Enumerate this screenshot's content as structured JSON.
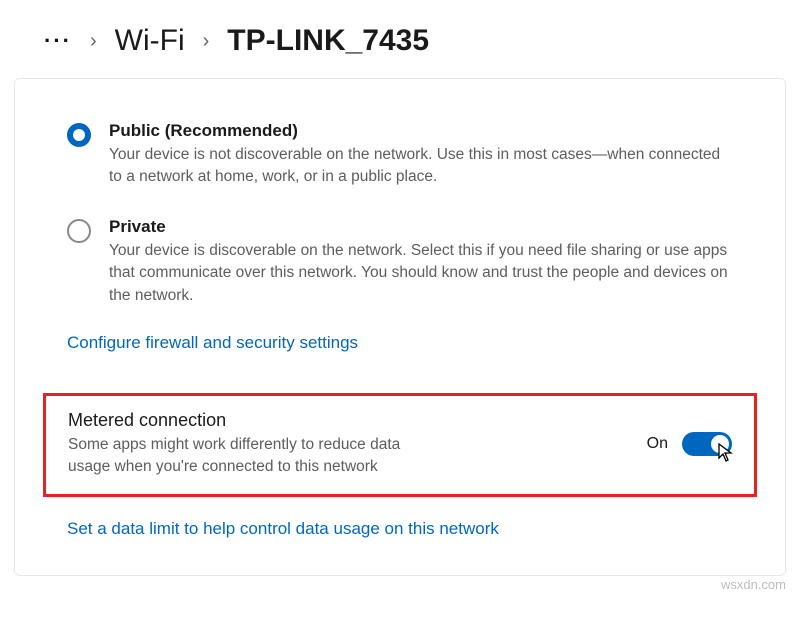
{
  "breadcrumb": {
    "wifi": "Wi-Fi",
    "network": "TP-LINK_7435"
  },
  "profiles": {
    "public": {
      "title": "Public (Recommended)",
      "desc": "Your device is not discoverable on the network. Use this in most cases—when connected to a network at home, work, or in a public place."
    },
    "private": {
      "title": "Private",
      "desc": "Your device is discoverable on the network. Select this if you need file sharing or use apps that communicate over this network. You should know and trust the people and devices on the network."
    }
  },
  "links": {
    "firewall": "Configure firewall and security settings",
    "datalimit": "Set a data limit to help control data usage on this network"
  },
  "metered": {
    "title": "Metered connection",
    "desc": "Some apps might work differently to reduce data usage when you're connected to this network",
    "state_label": "On",
    "on": true
  },
  "watermark": "wsxdn.com"
}
